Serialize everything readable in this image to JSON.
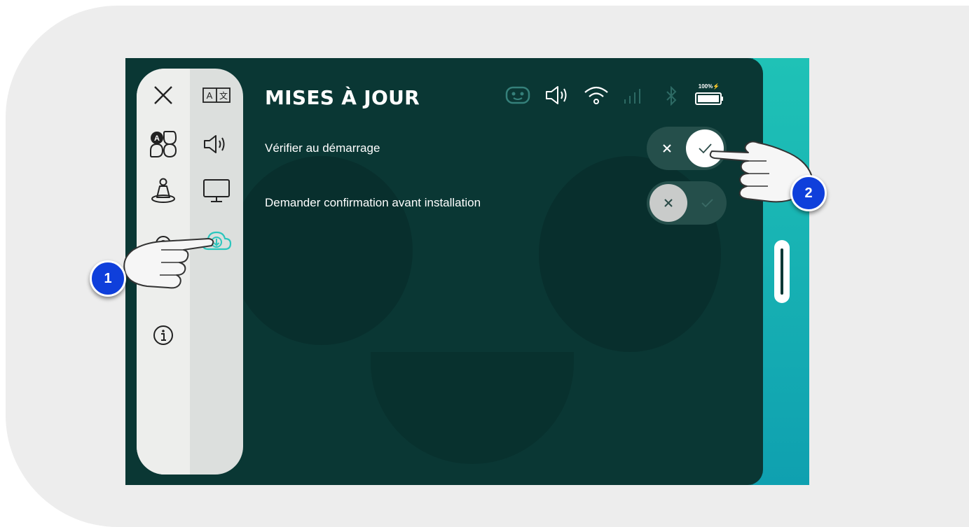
{
  "screen": {
    "title": "MISES À JOUR",
    "status_bar": {
      "icons": [
        "robot-face-icon",
        "speaker-icon",
        "wifi-icon",
        "signal-bars-icon",
        "bluetooth-icon",
        "battery-icon"
      ],
      "battery_label": "100%"
    },
    "settings": [
      {
        "label": "Vérifier au démarrage",
        "enabled": true
      },
      {
        "label": "Demander confirmation avant installation",
        "enabled": false
      }
    ]
  },
  "menu": {
    "items": [
      "close-icon",
      "language-icon",
      "apps-icon",
      "volume-icon",
      "pawn-icon",
      "display-icon",
      "settings-icon",
      "cloud-download-icon",
      "info-icon"
    ],
    "selected": "cloud-download-icon"
  },
  "annotations": [
    {
      "number": "1"
    },
    {
      "number": "2"
    }
  ],
  "colors": {
    "screen_bg": "#0a3734",
    "accent": "#2bc6bd",
    "badge": "#0f3fdb",
    "menu_bg": "#dcdfdd"
  }
}
